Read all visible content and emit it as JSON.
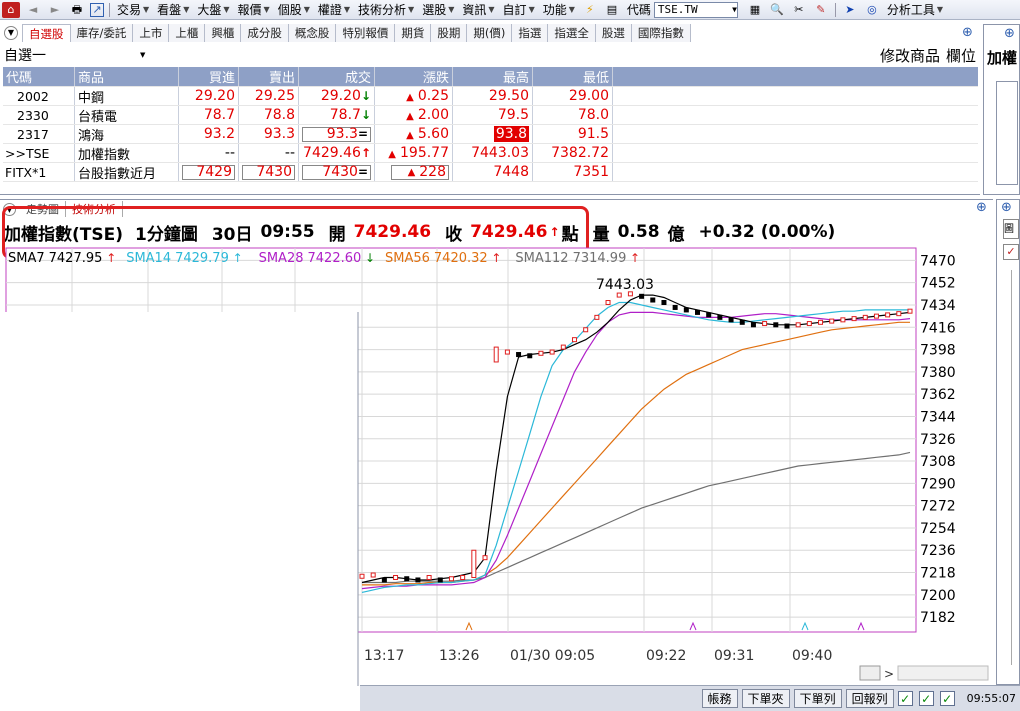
{
  "toolbar": {
    "menus": [
      "交易",
      "看盤",
      "大盤",
      "報價",
      "個股",
      "權證",
      "技術分析",
      "選股",
      "資訊",
      "自訂",
      "功能"
    ],
    "code_label": "代碼",
    "code_value": "TSE.TW",
    "analysis_tools": "分析工具"
  },
  "tabs": [
    "自選股",
    "庫存/委託",
    "上市",
    "上櫃",
    "興櫃",
    "成分股",
    "概念股",
    "特別報價",
    "期貨",
    "股期",
    "期(價)",
    "指選",
    "指選全",
    "股選",
    "國際指數"
  ],
  "watchlist": {
    "name": "自選一",
    "modify_btn": "修改商品",
    "field_btn": "欄位",
    "columns": [
      "代碼",
      "商品",
      "買進",
      "賣出",
      "成交",
      "漲跌",
      "最高",
      "最低"
    ],
    "rows": [
      {
        "code": "2002",
        "name": "中鋼",
        "bid": "29.20",
        "ask": "29.25",
        "last": "29.20",
        "last_arrow": "↓",
        "chg": "0.25",
        "high": "29.50",
        "low": "29.00"
      },
      {
        "code": "2330",
        "name": "台積電",
        "bid": "78.7",
        "ask": "78.8",
        "last": "78.7",
        "last_arrow": "↓",
        "chg": "2.00",
        "high": "79.5",
        "low": "78.0"
      },
      {
        "code": "2317",
        "name": "鴻海",
        "bid": "93.2",
        "ask": "93.3",
        "last": "93.3",
        "last_arrow": "=",
        "chg": "5.60",
        "high": "93.8",
        "low": "91.5"
      },
      {
        "code": ">>TSE",
        "name": "加權指數",
        "bid": "--",
        "ask": "--",
        "last": "7429.46",
        "last_arrow": "↑",
        "chg": "195.77",
        "high": "7443.03",
        "low": "7382.72"
      },
      {
        "code": "FITX*1",
        "name": "台股指數近月",
        "bid": "7429",
        "ask": "7430",
        "last": "7430",
        "last_arrow": "=",
        "chg": "228",
        "high": "7448",
        "low": "7351"
      }
    ],
    "right_label": "加權"
  },
  "chart_tabs": [
    "走勢圖",
    "技術分析"
  ],
  "chart_info": {
    "symbol": "加權指數(TSE)",
    "period": "1分鐘圖",
    "date": "30日",
    "time": "09:55",
    "open_label": "開",
    "open": "7429.46",
    "close_label": "收",
    "close": "7429.46",
    "unit": "點",
    "vol_label": "量",
    "vol": "0.58",
    "vol_unit": "億",
    "change": "+0.32",
    "change_pct": "(0.00%)"
  },
  "chart_data": {
    "type": "line",
    "legend": [
      {
        "name": "SMA7",
        "value": "7427.95",
        "color": "#000000"
      },
      {
        "name": "SMA14",
        "value": "7429.79",
        "color": "#2bb8d8"
      },
      {
        "name": "SMA28",
        "value": "7422.60",
        "color": "#b020c8"
      },
      {
        "name": "SMA56",
        "value": "7420.32",
        "color": "#e07010"
      },
      {
        "name": "SMA112",
        "value": "7314.99",
        "color": "#707070"
      }
    ],
    "ylim": [
      7170,
      7480
    ],
    "yticks": [
      7470,
      7452,
      7434,
      7416,
      7398,
      7380,
      7362,
      7344,
      7326,
      7308,
      7290,
      7272,
      7254,
      7236,
      7218,
      7200,
      7182
    ],
    "xticks": [
      "13:17",
      "13:26",
      "01/30 09:05",
      "09:22",
      "09:31",
      "09:40"
    ],
    "peak_label": "7443.03",
    "peak_value": 7443.03,
    "n": 60,
    "sma7": [
      7210,
      7212,
      7214,
      7214,
      7213,
      7212,
      7212,
      7213,
      7214,
      7216,
      7218,
      7230,
      7300,
      7360,
      7392,
      7394,
      7395,
      7396,
      7398,
      7402,
      7406,
      7412,
      7420,
      7430,
      7438,
      7442,
      7442,
      7440,
      7436,
      7432,
      7430,
      7428,
      7426,
      7424,
      7422,
      7420,
      7419,
      7418,
      7418,
      7418,
      7419,
      7420,
      7421,
      7422,
      7423,
      7424,
      7425,
      7426,
      7427,
      7428
    ],
    "sma14": [
      7202,
      7204,
      7206,
      7207,
      7208,
      7208,
      7209,
      7210,
      7210,
      7211,
      7212,
      7216,
      7240,
      7270,
      7300,
      7330,
      7360,
      7385,
      7398,
      7405,
      7415,
      7425,
      7432,
      7436,
      7436,
      7434,
      7432,
      7430,
      7428,
      7426,
      7424,
      7422,
      7421,
      7420,
      7420,
      7421,
      7422,
      7423,
      7424,
      7425,
      7426,
      7427,
      7428,
      7429,
      7429,
      7430,
      7430,
      7430,
      7430,
      7430
    ],
    "sma28": [
      7205,
      7206,
      7207,
      7207,
      7207,
      7208,
      7208,
      7208,
      7208,
      7209,
      7210,
      7214,
      7228,
      7248,
      7270,
      7292,
      7314,
      7336,
      7358,
      7380,
      7396,
      7410,
      7420,
      7426,
      7428,
      7428,
      7428,
      7427,
      7426,
      7425,
      7424,
      7424,
      7424,
      7424,
      7425,
      7426,
      7427,
      7427,
      7426,
      7425,
      7424,
      7423,
      7422,
      7422,
      7422,
      7422,
      7422,
      7422,
      7422,
      7423
    ],
    "sma56": [
      7208,
      7208,
      7208,
      7209,
      7209,
      7209,
      7210,
      7210,
      7210,
      7211,
      7212,
      7216,
      7222,
      7230,
      7240,
      7250,
      7260,
      7270,
      7280,
      7290,
      7300,
      7310,
      7320,
      7330,
      7340,
      7350,
      7358,
      7366,
      7372,
      7378,
      7382,
      7386,
      7390,
      7394,
      7398,
      7400,
      7402,
      7404,
      7406,
      7408,
      7410,
      7412,
      7414,
      7415,
      7416,
      7417,
      7418,
      7419,
      7420,
      7420
    ],
    "sma112": [
      7210,
      7210,
      7210,
      7210,
      7211,
      7211,
      7211,
      7211,
      7211,
      7212,
      7212,
      7214,
      7218,
      7222,
      7226,
      7230,
      7234,
      7238,
      7242,
      7246,
      7250,
      7254,
      7258,
      7262,
      7266,
      7270,
      7273,
      7276,
      7279,
      7282,
      7285,
      7288,
      7290,
      7292,
      7294,
      7296,
      7298,
      7300,
      7302,
      7304,
      7305,
      7306,
      7307,
      7308,
      7309,
      7310,
      7311,
      7312,
      7313,
      7315
    ],
    "close": [
      7215,
      7216,
      7212,
      7214,
      7213,
      7212,
      7214,
      7212,
      7213,
      7214,
      7220,
      7230,
      7392,
      7396,
      7394,
      7393,
      7395,
      7396,
      7400,
      7406,
      7414,
      7424,
      7436,
      7442,
      7443,
      7441,
      7438,
      7436,
      7432,
      7430,
      7428,
      7426,
      7424,
      7422,
      7420,
      7418,
      7419,
      7418,
      7417,
      7418,
      7419,
      7420,
      7421,
      7422,
      7423,
      7424,
      7425,
      7426,
      7427,
      7429
    ]
  },
  "status": {
    "buttons": [
      "帳務",
      "下單夾",
      "下單列",
      "回報列"
    ],
    "time": "09:55:07"
  }
}
